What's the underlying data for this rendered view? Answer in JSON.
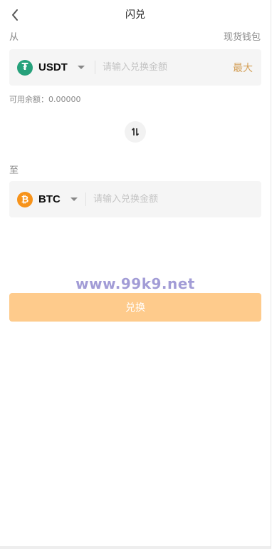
{
  "header": {
    "title": "闪兑",
    "back_icon": "chevron-left-icon"
  },
  "from": {
    "label": "从",
    "wallet_label": "现货钱包",
    "coin": {
      "symbol": "USDT",
      "icon": "tether-icon",
      "icon_glyph": "₮",
      "color": "#26a17b"
    },
    "input_placeholder": "请输入兑换金额",
    "input_value": "",
    "max_label": "最大",
    "balance_text": "可用余额：0.00000"
  },
  "switch": {
    "icon": "swap-arrows-icon"
  },
  "to": {
    "label": "至",
    "coin": {
      "symbol": "BTC",
      "icon": "bitcoin-icon",
      "icon_glyph": "₿",
      "color": "#f7931a"
    },
    "input_placeholder": "请输入兑换金额",
    "input_value": ""
  },
  "watermark": "www.99k9.net",
  "submit_label": "兑换",
  "colors": {
    "accent": "#d4a15a",
    "button": "#fecb8c",
    "panel": "#f5f5f5",
    "text_muted": "#888888",
    "watermark": "#a29cd6"
  }
}
